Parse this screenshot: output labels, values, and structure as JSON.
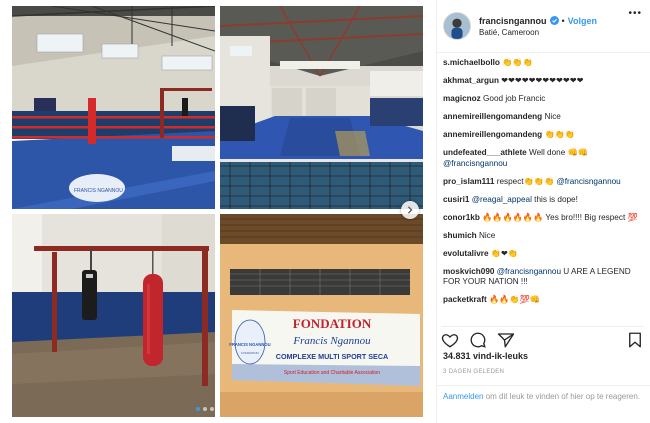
{
  "post": {
    "username": "francisngannou",
    "follow_label": "Volgen",
    "separator": "•",
    "location": "Batié, Cameroon",
    "likes": "34.831 vind-ik-leuks",
    "date": "3 DAGEN GELEDEN",
    "footer_login": "Aanmelden",
    "footer_text": " om dit leuk te vinden of hier op te reageren.",
    "more_label": "•••"
  },
  "banner": {
    "title": "FONDATION",
    "name": "Francis Ngannou",
    "subtitle": "COMPLEXE MULTI SPORT SECA",
    "tagline": "Sport Education and Charitable Association",
    "logo_text": "FRANCIS NGANNOU",
    "logo_sub": "FONDATION"
  },
  "comments": [
    {
      "user": "s.michaelbollo",
      "text": "👏👏👏",
      "mention": ""
    },
    {
      "user": "akhmat_argun",
      "text": "❤❤❤❤❤❤❤❤❤❤❤❤",
      "mention": ""
    },
    {
      "user": "magicnoz",
      "text": "Good job Francic",
      "mention": ""
    },
    {
      "user": "annemireillengomandeng",
      "text": "Nice",
      "mention": ""
    },
    {
      "user": "annemireillengomandeng",
      "text": "👏👏👏",
      "mention": ""
    },
    {
      "user": "undefeated___athlete",
      "text": "Well done 👊👊",
      "mention": "@francisngannou"
    },
    {
      "user": "pro_islam111",
      "text": "respect👏👏👏",
      "mention": "@francisngannou"
    },
    {
      "user": "cusiri1",
      "text": " this is dope!",
      "mention": "@reagal_appeal"
    },
    {
      "user": "conor1kb",
      "text": "🔥🔥🔥🔥🔥🔥 Yes bro!!!! Big respect 💯",
      "mention": ""
    },
    {
      "user": "shumich",
      "text": "Nice",
      "mention": ""
    },
    {
      "user": "evolutalivre",
      "text": "👏❤👏",
      "mention": ""
    },
    {
      "user": "moskvich090",
      "text": " U ARE A LEGEND FOR YOUR NATION !!!",
      "mention": "@francisngannou"
    },
    {
      "user": "packetkraft",
      "text": "🔥🔥👏💯👊",
      "mention": ""
    }
  ],
  "icons": {
    "like": "heart-icon",
    "comment": "comment-icon",
    "share": "share-icon",
    "save": "bookmark-icon",
    "verified": "verified-badge-icon",
    "next": "chevron-right-icon"
  },
  "colors": {
    "accent": "#3897f0",
    "mention": "#003569",
    "ring_red": "#d42a2a",
    "ring_blue": "#2a4fa8",
    "banner_red": "#c8202a",
    "banner_blue": "#1e3f93"
  }
}
